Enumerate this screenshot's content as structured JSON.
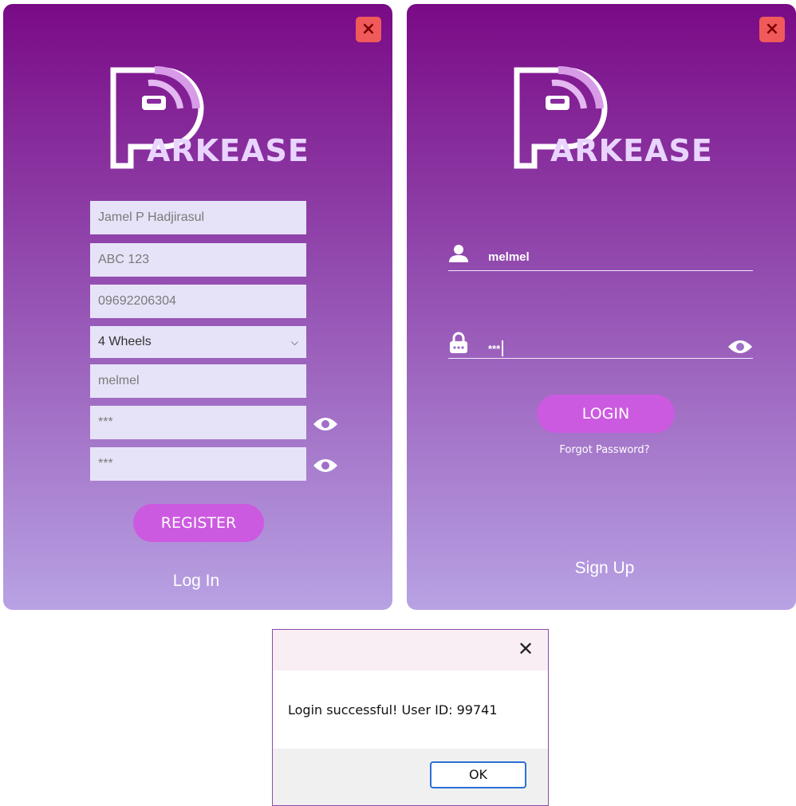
{
  "brand": {
    "logo_text": "ARKEASE"
  },
  "icons": {
    "close": "close-icon",
    "eye": "eye-icon",
    "user": "user-icon",
    "lock": "lock-icon",
    "chevron": "chevron-down-icon"
  },
  "colors": {
    "panel_top": "#7a0a86",
    "panel_bottom": "#b8a2e4",
    "button": "#cc5ae0",
    "close_button": "#f05a5a",
    "field_bg": "#e6e3f8"
  },
  "register": {
    "close_label": "×",
    "full_name": "Jamel P Hadjirasul",
    "plate_number": "ABC 123",
    "phone": "09692206304",
    "vehicle_type": "4 Wheels",
    "username": "melmel",
    "password": "***",
    "confirm_password": "***",
    "register_button": "REGISTER",
    "login_link": "Log In"
  },
  "login": {
    "close_label": "×",
    "username": "melmel",
    "password": "***",
    "login_button": "LOGIN",
    "forgot_link": "Forgot Password?",
    "signup_link": "Sign Up"
  },
  "dialog": {
    "close_label": "✕",
    "message": "Login successful! User ID: 99741",
    "ok_button": "OK"
  }
}
